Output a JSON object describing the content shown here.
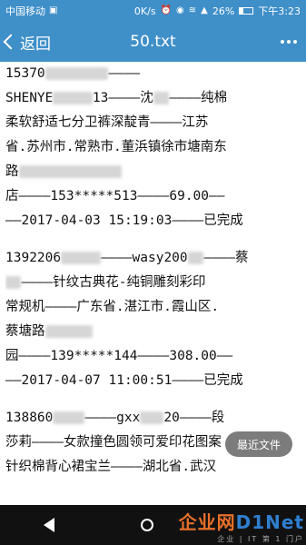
{
  "status_bar": {
    "carrier": "中国移动",
    "speed": "0K/s",
    "battery": "26%",
    "time": "下午3:23"
  },
  "toolbar": {
    "back_label": "返回",
    "title": "50.txt"
  },
  "lines": [
    "15370▒▒▒▒▒▒▒▒――――",
    "SHENYE▒▒▒▒▒13――――沈▒▒――――纯棉",
    "柔软舒适七分卫裤深靛青――――江苏",
    "省.苏州市.常熟市.董浜镇徐市塘南东",
    "路▒▒▒▒▒▒▒▒▒▒▒▒▒",
    "店――――153*****513――――69.00――",
    "――2017-04-03 15:19:03――――已完成",
    "",
    "1392206▒▒▒▒▒――――wasy200▒▒――――蔡",
    "▒▒――――针纹古典花-纯铜雕刻彩印",
    "常规机――――广东省.湛江市.霞山区.",
    "蔡塘路▒▒▒▒▒▒",
    "园――――139*****144――――308.00――",
    "――2017-04-07 11:00:51――――已完成",
    "",
    "138860▒▒▒▒――――gxx▒▒▒20――――段",
    "莎莉――――女款撞色圆领可爱印花图案",
    "针织棉背心裙宝兰――――湖北省.武汉"
  ],
  "recent_files_button": "最近文件",
  "watermark": {
    "main_a": "企业网",
    "main_b": "D1Net",
    "sub": "企业 | IT 第 1 门户"
  },
  "colors": {
    "header_bg": "#3f8fc9",
    "navbar_bg": "#111111",
    "watermark_orange": "#e8702a",
    "watermark_blue": "#2f7fd0"
  }
}
